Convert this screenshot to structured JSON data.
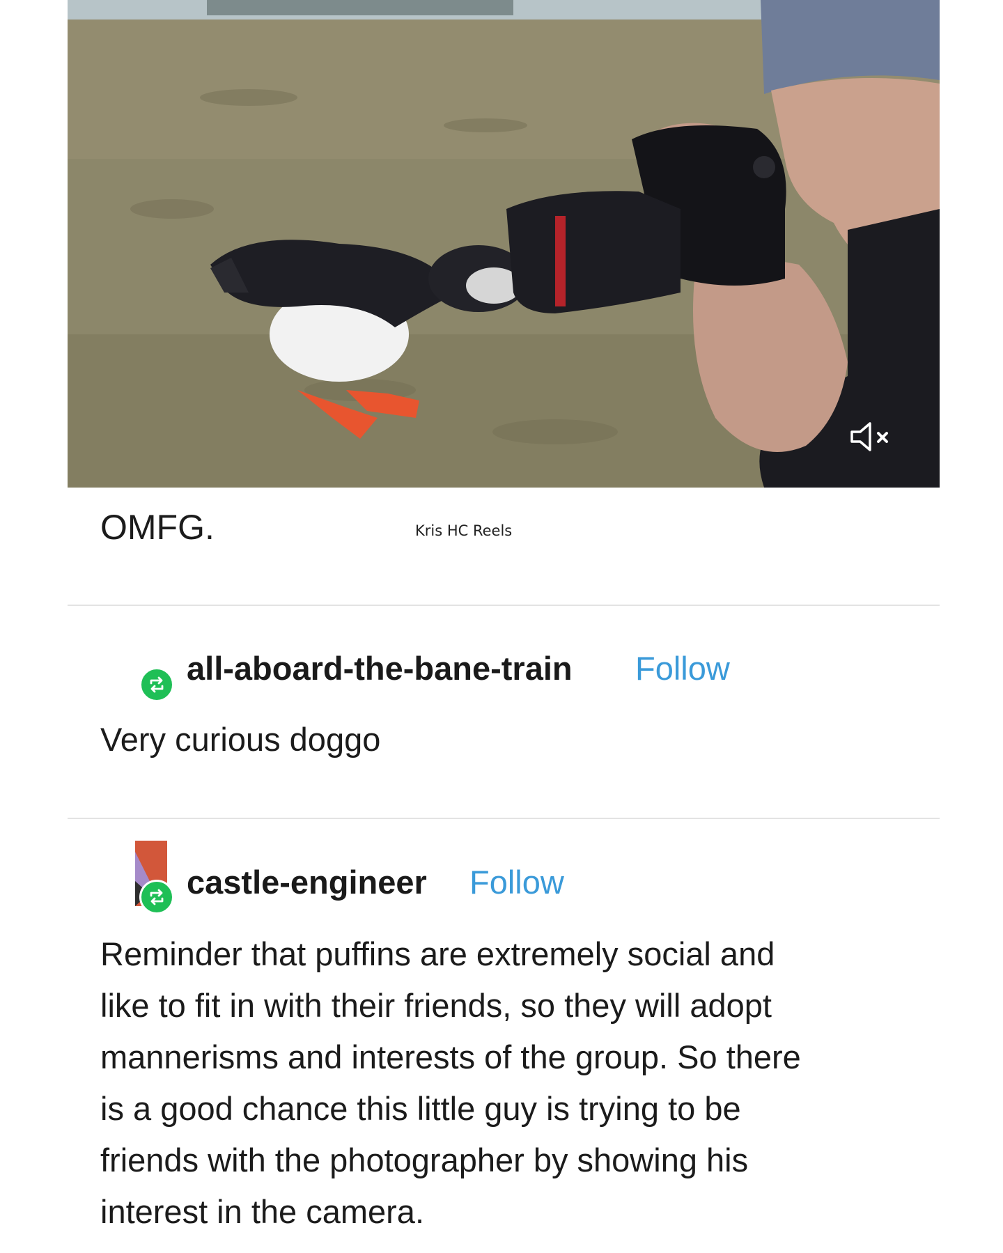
{
  "post": {
    "caption": "OMFG.",
    "credit": "Kris HC Reels",
    "media": {
      "mute_icon": "speaker-muted-icon"
    }
  },
  "reblogs": [
    {
      "username": "all-aboard-the-bane-train",
      "follow_label": "Follow",
      "badge_icon": "reblog-icon",
      "text_lines": [
        "Very curious doggo"
      ]
    },
    {
      "username": "castle-engineer",
      "follow_label": "Follow",
      "badge_icon": "reblog-icon",
      "text_lines": [
        "Reminder that puffins are extremely social and",
        "like to fit in with their friends, so they will adopt",
        "mannerisms and interests of the group. So there",
        "is a good chance this little guy is trying to be",
        "friends with the photographer by showing his",
        "interest in the camera."
      ]
    }
  ],
  "colors": {
    "follow": "#3a9ad9",
    "reblog_badge": "#1fbf56",
    "divider": "#e3e3e3"
  }
}
